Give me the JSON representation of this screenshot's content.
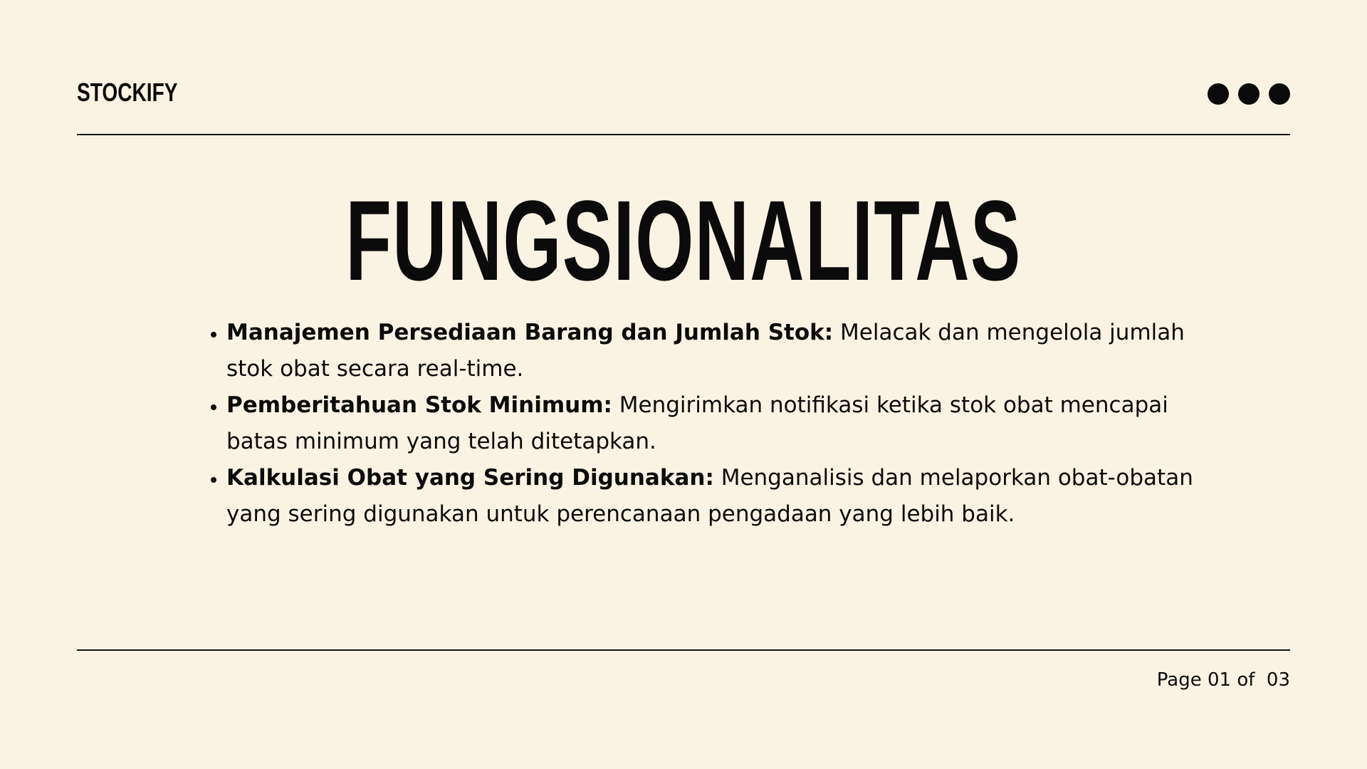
{
  "brand": "STOCKIFY",
  "header_menu_icon": "more-dots-icon",
  "title": "FUNGSIONALITAS",
  "features": [
    {
      "lead": "Manajemen Persediaan Barang dan Jumlah Stok:",
      "text": " Melacak dan mengelola jumlah stok obat secara real-time."
    },
    {
      "lead": "Pemberitahuan Stok Minimum:",
      "text": " Mengirimkan notifikasi ketika stok obat mencapai batas minimum yang telah ditetapkan."
    },
    {
      "lead": "Kalkulasi Obat yang Sering Digunakan:",
      "text": " Menganalisis dan melaporkan obat-obatan yang sering digunakan untuk perencanaan pengadaan yang lebih baik."
    }
  ],
  "footer": {
    "page_label": "Page 01 of  03"
  },
  "colors": {
    "background": "#FAF3E4",
    "text": "#0b0b0b"
  }
}
